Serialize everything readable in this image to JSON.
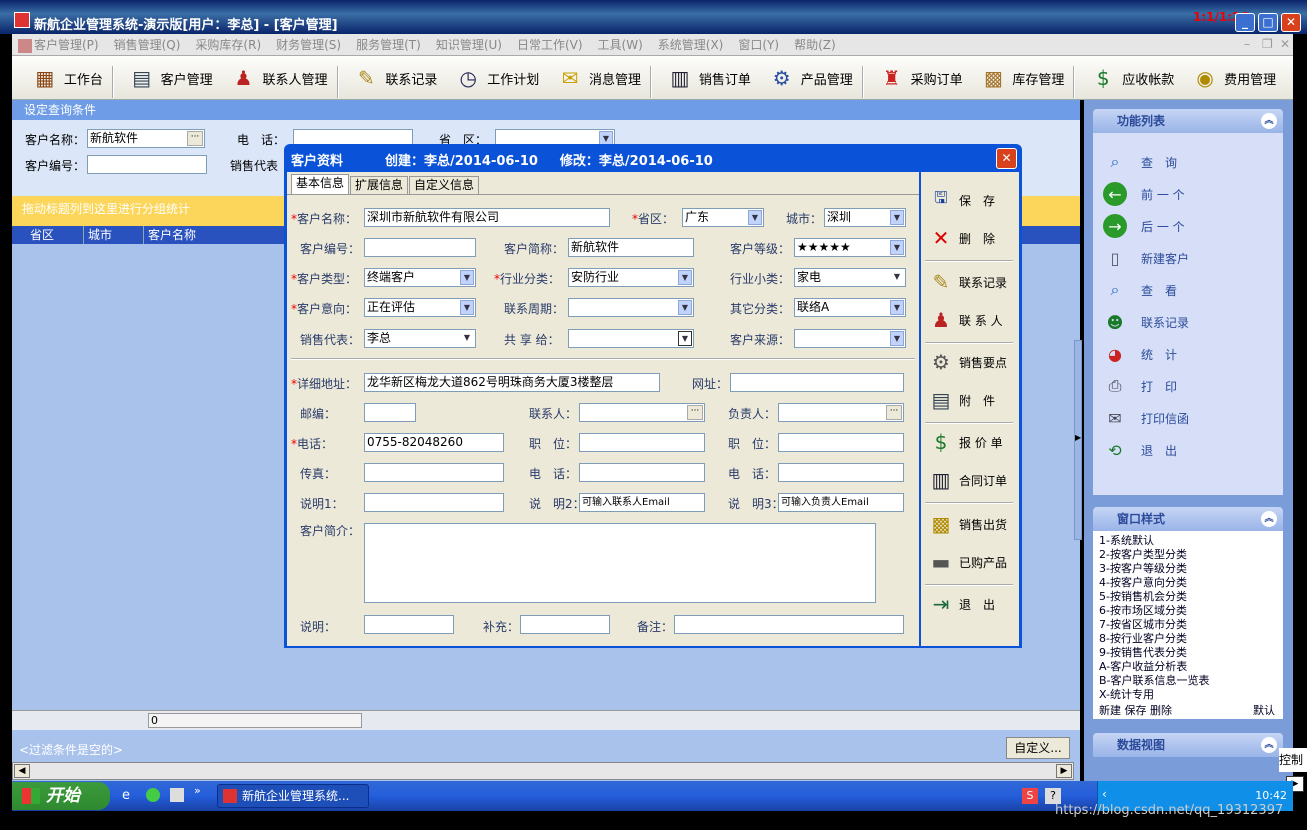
{
  "app": {
    "title": "新航企业管理系统-演示版[用户：李总] - [客户管理]",
    "clock": "1:1/1:26"
  },
  "menu": [
    "客户管理(P)",
    "销售管理(Q)",
    "采购库存(R)",
    "财务管理(S)",
    "服务管理(T)",
    "知识管理(U)",
    "日常工作(V)",
    "工具(W)",
    "系统管理(X)",
    "窗口(Y)",
    "帮助(Z)"
  ],
  "toolbar": [
    {
      "label": "工作台",
      "icon": "desk-icon"
    },
    {
      "label": "客户管理",
      "icon": "customer-icon"
    },
    {
      "label": "联系人管理",
      "icon": "contacts-icon"
    },
    {
      "label": "联系记录",
      "icon": "record-icon"
    },
    {
      "label": "工作计划",
      "icon": "clock-icon"
    },
    {
      "label": "消息管理",
      "icon": "message-icon"
    },
    {
      "label": "销售订单",
      "icon": "order-icon"
    },
    {
      "label": "产品管理",
      "icon": "product-icon"
    },
    {
      "label": "采购订单",
      "icon": "purchase-icon"
    },
    {
      "label": "库存管理",
      "icon": "stock-icon"
    },
    {
      "label": "应收帐款",
      "icon": "receivable-icon"
    },
    {
      "label": "费用管理",
      "icon": "expense-icon"
    }
  ],
  "query": {
    "header": "设定查询条件",
    "name_label": "客户名称：",
    "name_value": "新航软件",
    "phone_label": "电　话：",
    "province_label": "省　区：",
    "code_label": "客户编号：",
    "sales_label": "销售代表"
  },
  "group_hint": "拖动标题列到这里进行分组统计",
  "grid": {
    "columns": [
      "省区",
      "城市",
      "客户名称"
    ],
    "footer_value": "0"
  },
  "filter": {
    "text": "<过滤条件是空的>",
    "custom_button": "自定义..."
  },
  "right": {
    "functions_title": "功能列表",
    "functions": [
      {
        "label": "查　询",
        "icon": "search-icon"
      },
      {
        "label": "前 一 个",
        "icon": "prev-icon"
      },
      {
        "label": "后 一 个",
        "icon": "next-icon"
      },
      {
        "label": "新建客户",
        "icon": "new-doc-icon"
      },
      {
        "label": "查　看",
        "icon": "view-icon"
      },
      {
        "label": "联系记录",
        "icon": "contact-record-icon"
      },
      {
        "label": "统　计",
        "icon": "chart-icon"
      },
      {
        "label": "打　印",
        "icon": "printer-icon"
      },
      {
        "label": "打印信函",
        "icon": "letter-icon"
      },
      {
        "label": "退　出",
        "icon": "exit-icon"
      }
    ],
    "styles_title": "窗口样式",
    "styles": [
      "1-系统默认",
      "2-按客户类型分类",
      "3-按客户等级分类",
      "4-按客户意向分类",
      "5-按销售机会分类",
      "6-按市场区域分类",
      "7-按省区城市分类",
      "8-按行业客户分类",
      "9-按销售代表分类",
      "A-客户收益分析表",
      "B-客户联系信息一览表",
      "X-统计专用"
    ],
    "styles_actions": {
      "new": "新建",
      "save": "保存",
      "delete": "删除",
      "default": "默认"
    },
    "dataview_title": "数据视图",
    "control_label": "控制"
  },
  "dialog": {
    "title": "客户资料",
    "created": "创建：李总/2014-06-10",
    "modified": "修改：李总/2014-06-10",
    "tabs": [
      "基本信息",
      "扩展信息",
      "自定义信息"
    ],
    "fields": {
      "name_label": "客户名称：",
      "name": "深圳市新航软件有限公司",
      "province_label": "省区：",
      "province": "广东",
      "city_label": "城市：",
      "city": "深圳",
      "code_label": "客户编号：",
      "code": "",
      "short_label": "客户简称：",
      "short": "新航软件",
      "level_label": "客户等级：",
      "level": "★★★★★",
      "type_label": "客户类型：",
      "type": "终端客户",
      "industry_label": "行业分类：",
      "industry": "安防行业",
      "subindustry_label": "行业小类：",
      "subindustry": "家电",
      "intent_label": "客户意向：",
      "intent": "正在评估",
      "cycle_label": "联系周期：",
      "cycle": "",
      "other_label": "其它分类：",
      "other": "联络A",
      "sales_label": "销售代表：",
      "sales": "李总",
      "share_label": "共 享 给：",
      "share": "",
      "source_label": "客户来源：",
      "source": "",
      "address_label": "详细地址：",
      "address": "龙华新区梅龙大道862号明珠商务大厦3楼整层",
      "web_label": "网址：",
      "web": "",
      "zip_label": "邮编：",
      "zip": "",
      "contact_label": "联系人：",
      "contact": "",
      "owner_label": "负责人：",
      "owner": "",
      "tel_label": "电话：",
      "tel": "0755-82048260",
      "pos1_label": "职　位：",
      "pos1": "",
      "pos2_label": "职　位：",
      "pos2": "",
      "fax_label": "传真：",
      "fax": "",
      "tel2_label": "电　话：",
      "tel2": "",
      "tel3_label": "电　话：",
      "tel3": "",
      "note1_label": "说明1：",
      "note1": "",
      "note2_label": "说　明2：",
      "note2": "可输入联系人Email",
      "note3_label": "说　明3：",
      "note3": "可输入负责人Email",
      "intro_label": "客户简介：",
      "intro": "",
      "desc_label": "说明：",
      "desc": "",
      "extra_label": "补充：",
      "extra": "",
      "remark_label": "备注：",
      "remark": ""
    },
    "side": [
      {
        "label": "保　存",
        "icon": "save-icon"
      },
      {
        "label": "删　除",
        "icon": "delete-icon"
      },
      {
        "label": "联系记录",
        "icon": "record-icon"
      },
      {
        "label": "联 系 人",
        "icon": "contacts-icon"
      },
      {
        "label": "销售要点",
        "icon": "keypoint-icon"
      },
      {
        "label": "附　件",
        "icon": "attachment-icon"
      },
      {
        "label": "报 价 单",
        "icon": "quote-icon"
      },
      {
        "label": "合同订单",
        "icon": "contract-icon"
      },
      {
        "label": "销售出货",
        "icon": "shipping-icon"
      },
      {
        "label": "已购产品",
        "icon": "chip-icon"
      },
      {
        "label": "退　出",
        "icon": "exit-icon"
      }
    ]
  },
  "taskbar": {
    "start": "开始",
    "task": "新航企业管理系统...",
    "clock": "10:42"
  },
  "watermark": "https://blog.csdn.net/qq_19312397"
}
